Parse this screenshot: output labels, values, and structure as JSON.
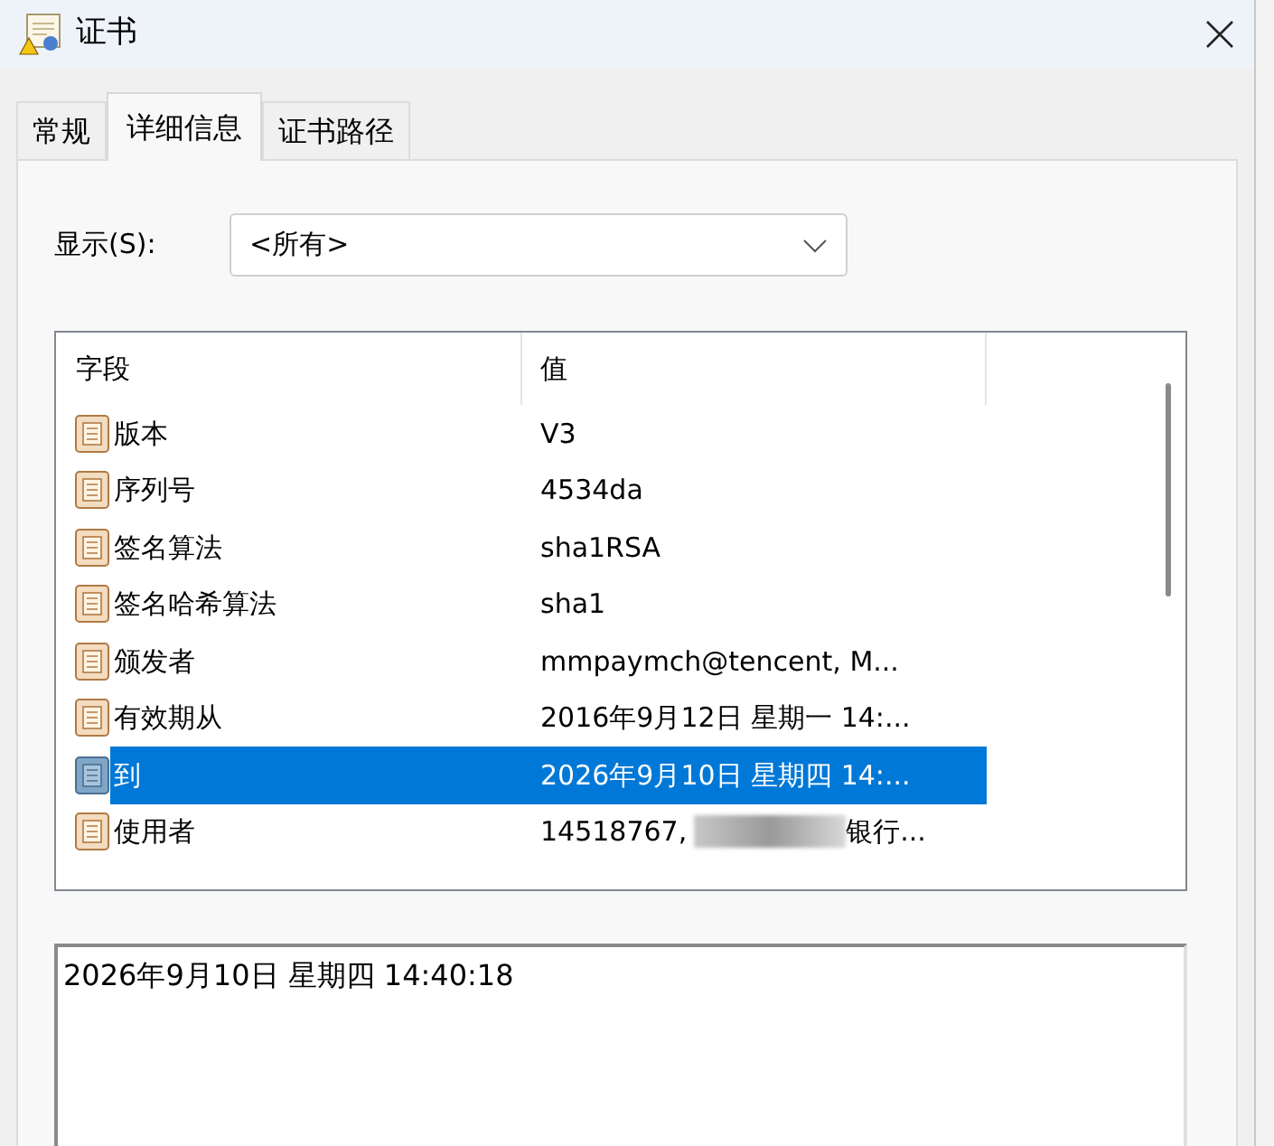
{
  "window": {
    "title": "证书"
  },
  "tabs": [
    {
      "label": "常规",
      "selected": false
    },
    {
      "label": "详细信息",
      "selected": true
    },
    {
      "label": "证书路径",
      "selected": false
    }
  ],
  "show": {
    "label": "显示(S):",
    "value": "<所有>"
  },
  "table": {
    "columns": [
      "字段",
      "值"
    ],
    "rows": [
      {
        "field": "版本",
        "value": "V3",
        "selected": false
      },
      {
        "field": "序列号",
        "value": "4534da",
        "selected": false
      },
      {
        "field": "签名算法",
        "value": "sha1RSA",
        "selected": false
      },
      {
        "field": "签名哈希算法",
        "value": "sha1",
        "selected": false
      },
      {
        "field": "颁发者",
        "value": "mmpaymch@tencent, M...",
        "selected": false
      },
      {
        "field": "有效期从",
        "value": "2016年9月12日 星期一 14:...",
        "selected": false
      },
      {
        "field": "到",
        "value": "2026年9月10日 星期四 14:...",
        "selected": true
      },
      {
        "field": "使用者",
        "value": "14518767,",
        "redacted": true,
        "value_after": "银行...",
        "selected": false
      }
    ]
  },
  "detail": {
    "value": "2026年9月10日 星期四 14:40:18"
  }
}
